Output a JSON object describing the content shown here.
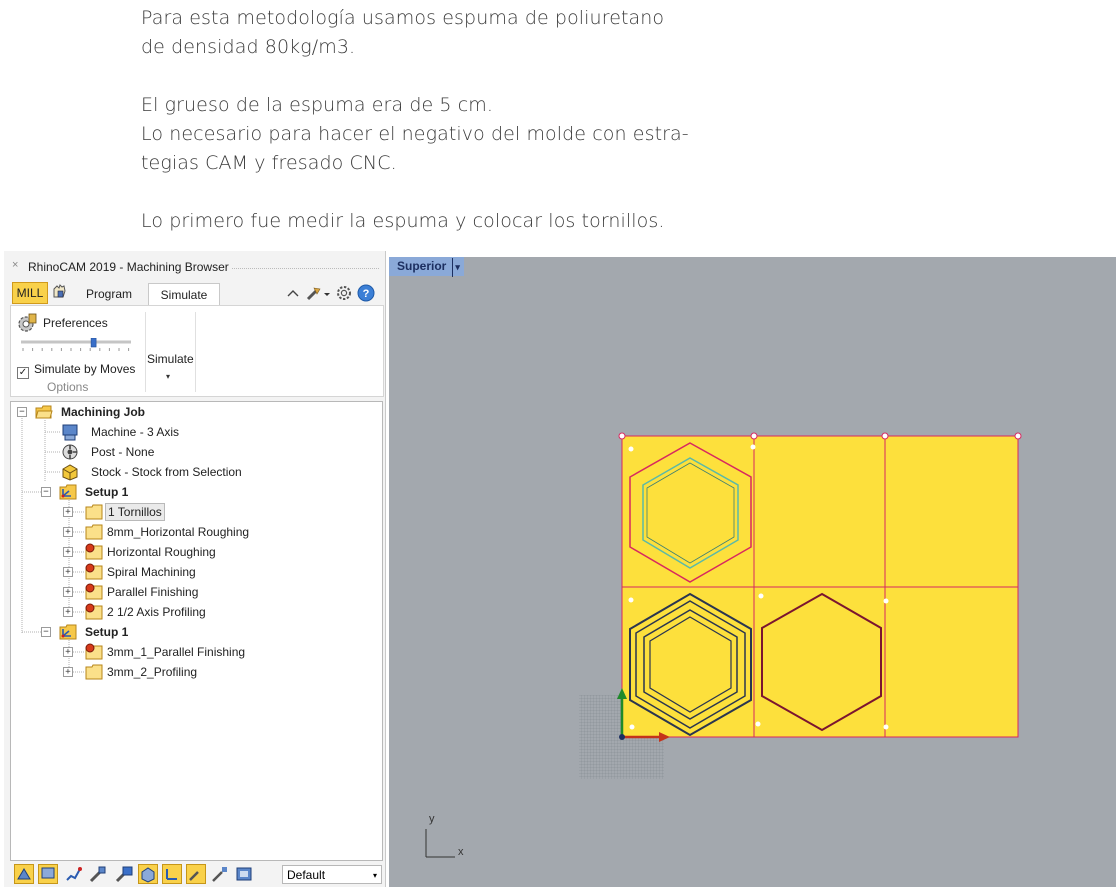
{
  "prose": {
    "p1_line1": "Para esta metodología usamos espuma de poliuretano",
    "p1_line2": "de densidad 80kg/m3.",
    "p2_line1": "El grueso de la espuma era de 5 cm.",
    "p2_line2": "Lo necesario para hacer el negativo del molde con estra-",
    "p2_line3": "tegias CAM y fresado CNC.",
    "p3_line1": "Lo primero fue medir la espuma y colocar los tornillos."
  },
  "panel": {
    "title": "RhinoCAM 2019 - Machining Browser",
    "close_glyph": "×",
    "tabs": {
      "mill": "MILL",
      "program": "Program",
      "simulate": "Simulate"
    },
    "ribbon": {
      "preferences": "Preferences",
      "simulate_by_moves": "Simulate by Moves",
      "simulate_by_moves_checked": "✓",
      "simulate_button": "Simulate",
      "simulate_caret": "▾",
      "options_group": "Options",
      "slider_fraction": 0.66
    },
    "tree": {
      "job": "Machining Job",
      "machine": "Machine - 3 Axis",
      "post": "Post - None",
      "stock": "Stock - Stock from Selection",
      "setup1": "Setup 1",
      "op1": "1 Tornillos",
      "op2": "8mm_Horizontal Roughing",
      "op3": "Horizontal Roughing",
      "op4": "Spiral Machining",
      "op5": "Parallel Finishing",
      "op6": "2 1/2 Axis Profiling",
      "setup2": "Setup 1",
      "op7": "3mm_1_Parallel Finishing",
      "op8": "3mm_2_Profiling",
      "expand_glyph": "+",
      "collapse_glyph": "−"
    },
    "bottom": {
      "combo_value": "Default",
      "combo_arrow": "▾"
    }
  },
  "viewport": {
    "label": "Superior",
    "label_dropdown": "▾",
    "axis_x": "x",
    "axis_y": "y"
  },
  "colors": {
    "stock_yellow": "#fde03c",
    "outline_magenta": "#d8285f",
    "toolpath_dark": "#2a3550",
    "profile_maroon": "#7b1530",
    "inner_cyan": "#5bb9a8",
    "viewport_bg": "#a3a8ae",
    "mill_tab": "#f9d14a",
    "viewport_label_bg": "#8aa9d8"
  }
}
